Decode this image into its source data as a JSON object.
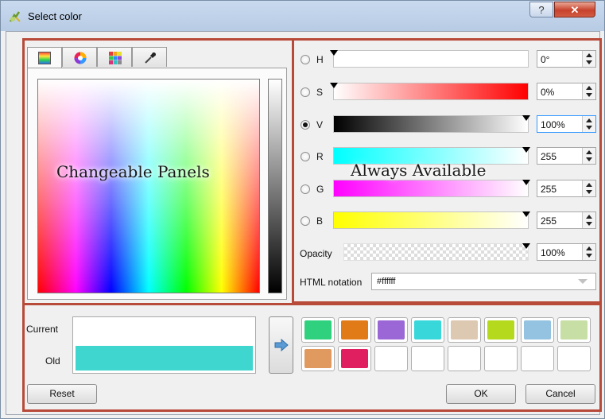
{
  "window": {
    "title": "Select color",
    "help_label": "?",
    "close_label": "✕"
  },
  "annotations": {
    "left": "Changeable Panels",
    "right": "Always Available"
  },
  "tabs": [
    {
      "icon": "color-box-icon",
      "active": true
    },
    {
      "icon": "color-wheel-icon",
      "active": false
    },
    {
      "icon": "swatch-grid-icon",
      "active": false
    },
    {
      "icon": "color-picker-icon",
      "active": false
    }
  ],
  "channels": {
    "h": {
      "label": "H",
      "value": "0°",
      "checked": false,
      "color": "#ffffff"
    },
    "s": {
      "label": "S",
      "value": "0%",
      "checked": false,
      "color": "#ff0000"
    },
    "v": {
      "label": "V",
      "value": "100%",
      "checked": true,
      "color": "#ffffff"
    },
    "r": {
      "label": "R",
      "value": "255",
      "checked": false,
      "color": "#00ffff"
    },
    "g": {
      "label": "G",
      "value": "255",
      "checked": false,
      "color": "#ff00ff"
    },
    "b": {
      "label": "B",
      "value": "255",
      "checked": false,
      "color": "#ffff00"
    }
  },
  "opacity": {
    "label": "Opacity",
    "value": "100%"
  },
  "html_notation": {
    "label": "HTML notation",
    "value": "#ffffff"
  },
  "preview": {
    "current_label": "Current",
    "old_label": "Old",
    "current_color": "#ffffff",
    "old_color": "#3fd6d0"
  },
  "swatches": [
    "#2fd17f",
    "#e07b18",
    "#9b66d6",
    "#37d7da",
    "#ddc8b1",
    "#b5d91c",
    "#93c3e0",
    "#c7dfa5",
    "#e09a5f",
    "#df1f5f",
    "#ffffff",
    "#ffffff",
    "#ffffff",
    "#ffffff",
    "#ffffff",
    "#ffffff"
  ],
  "buttons": {
    "reset": "Reset",
    "ok": "OK",
    "cancel": "Cancel"
  }
}
